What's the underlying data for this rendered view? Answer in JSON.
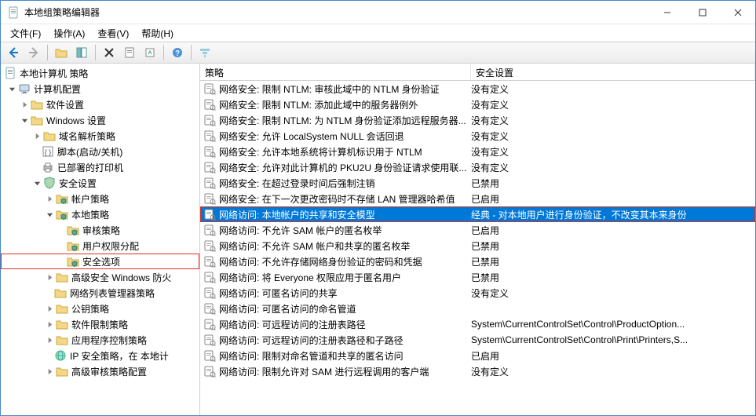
{
  "window": {
    "title": "本地组策略编辑器"
  },
  "menu": {
    "file": "文件(F)",
    "action": "操作(A)",
    "view": "查看(V)",
    "help": "帮助(H)"
  },
  "tree": {
    "root": "本地计算机 策略",
    "computer_config": "计算机配置",
    "software_settings": "软件设置",
    "windows_settings": "Windows 设置",
    "name_resolution": "域名解析策略",
    "scripts": "脚本(启动/关机)",
    "deployed_printers": "已部署的打印机",
    "security_settings": "安全设置",
    "account_policies": "帐户策略",
    "local_policies": "本地策略",
    "audit_policy": "审核策略",
    "user_rights": "用户权限分配",
    "security_options": "安全选项",
    "winfw": "高级安全 Windows 防火",
    "netlist": "网络列表管理器策略",
    "public_key": "公钥策略",
    "software_restriction": "软件限制策略",
    "appctrl": "应用程序控制策略",
    "ipsec": "IP 安全策略，在 本地计",
    "adv_audit": "高级审核策略配置"
  },
  "columns": {
    "policy": "策略",
    "setting": "安全设置"
  },
  "rows": [
    {
      "policy": "网络安全: 限制 NTLM: 审核此域中的 NTLM 身份验证",
      "setting": "没有定义",
      "selected": false
    },
    {
      "policy": "网络安全: 限制 NTLM: 添加此域中的服务器例外",
      "setting": "没有定义",
      "selected": false
    },
    {
      "policy": "网络安全: 限制 NTLM: 为 NTLM 身份验证添加远程服务器...",
      "setting": "没有定义",
      "selected": false
    },
    {
      "policy": "网络安全: 允许 LocalSystem NULL 会话回退",
      "setting": "没有定义",
      "selected": false
    },
    {
      "policy": "网络安全: 允许本地系统将计算机标识用于 NTLM",
      "setting": "没有定义",
      "selected": false
    },
    {
      "policy": "网络安全: 允许对此计算机的 PKU2U 身份验证请求使用联...",
      "setting": "没有定义",
      "selected": false
    },
    {
      "policy": "网络安全: 在超过登录时间后强制注销",
      "setting": "已禁用",
      "selected": false
    },
    {
      "policy": "网络安全: 在下一次更改密码时不存储 LAN 管理器哈希值",
      "setting": "已启用",
      "selected": false
    },
    {
      "policy": "网络访问: 本地帐户的共享和安全模型",
      "setting": "经典 - 对本地用户进行身份验证，不改变其本来身份",
      "selected": true
    },
    {
      "policy": "网络访问: 不允许 SAM 帐户的匿名枚举",
      "setting": "已启用",
      "selected": false
    },
    {
      "policy": "网络访问: 不允许 SAM 帐户和共享的匿名枚举",
      "setting": "已禁用",
      "selected": false
    },
    {
      "policy": "网络访问: 不允许存储网络身份验证的密码和凭据",
      "setting": "已禁用",
      "selected": false
    },
    {
      "policy": "网络访问: 将 Everyone 权限应用于匿名用户",
      "setting": "已禁用",
      "selected": false
    },
    {
      "policy": "网络访问: 可匿名访问的共享",
      "setting": "没有定义",
      "selected": false
    },
    {
      "policy": "网络访问: 可匿名访问的命名管道",
      "setting": "",
      "selected": false
    },
    {
      "policy": "网络访问: 可远程访问的注册表路径",
      "setting": "System\\CurrentControlSet\\Control\\ProductOption...",
      "selected": false
    },
    {
      "policy": "网络访问: 可远程访问的注册表路径和子路径",
      "setting": "System\\CurrentControlSet\\Control\\Print\\Printers,S...",
      "selected": false
    },
    {
      "policy": "网络访问: 限制对命名管道和共享的匿名访问",
      "setting": "已启用",
      "selected": false
    },
    {
      "policy": "网络访问: 限制允许对 SAM 进行远程调用的客户端",
      "setting": "没有定义",
      "selected": false
    }
  ]
}
